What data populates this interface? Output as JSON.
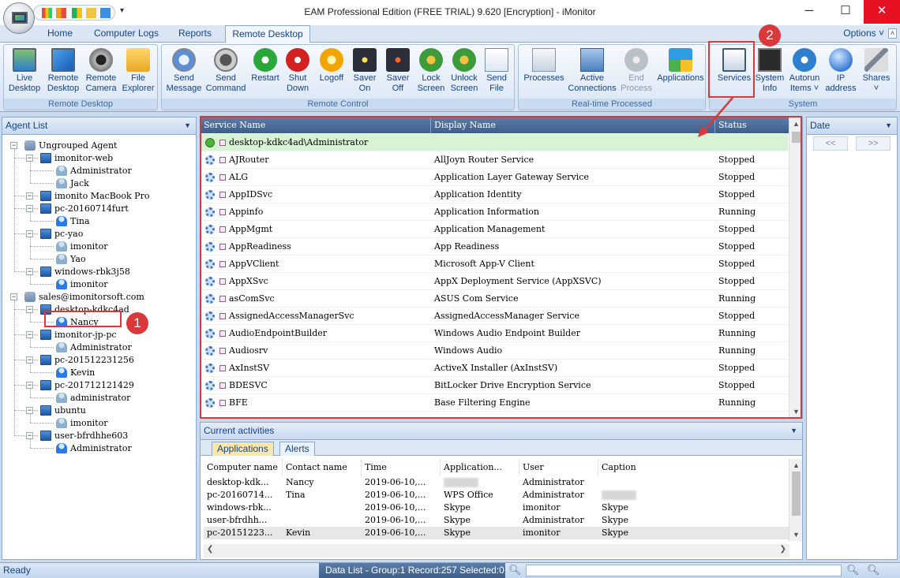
{
  "window": {
    "title": "EAM Professional Edition (FREE TRIAL) 9.620 [Encryption] - iMonitor",
    "minimize": "─",
    "maximize": "☐",
    "close": "✕"
  },
  "ribbon_tabs": [
    "Home",
    "Computer Logs",
    "Reports",
    "Remote Desktop"
  ],
  "active_tab": "Remote Desktop",
  "options_label": "Options ˅",
  "groups": {
    "remote_desktop": {
      "label": "Remote Desktop",
      "buttons": [
        {
          "l1": "Live",
          "l2": "Desktop",
          "icon": "monitor-icon"
        },
        {
          "l1": "Remote",
          "l2": "Desktop",
          "icon": "remote-desktop-icon"
        },
        {
          "l1": "Remote",
          "l2": "Camera",
          "icon": "webcam-icon"
        },
        {
          "l1": "File",
          "l2": "Explorer",
          "icon": "folder-icon"
        }
      ]
    },
    "remote_control": {
      "label": "Remote Control",
      "buttons": [
        {
          "l1": "Send",
          "l2": "Message",
          "icon": "message-icon"
        },
        {
          "l1": "Send",
          "l2": "Command",
          "icon": "command-icon"
        },
        {
          "l1": "Restart",
          "l2": "",
          "icon": "restart-icon"
        },
        {
          "l1": "Shut",
          "l2": "Down",
          "icon": "power-icon"
        },
        {
          "l1": "Logoff",
          "l2": "",
          "icon": "key-icon"
        },
        {
          "l1": "Saver",
          "l2": "On",
          "icon": "screensaver-on-icon"
        },
        {
          "l1": "Saver",
          "l2": "Off",
          "icon": "screensaver-off-icon"
        },
        {
          "l1": "Lock",
          "l2": "Screen",
          "icon": "lock-screen-icon"
        },
        {
          "l1": "Unlock",
          "l2": "Screen",
          "icon": "unlock-screen-icon"
        },
        {
          "l1": "Send",
          "l2": "File",
          "icon": "send-file-icon"
        }
      ]
    },
    "realtime": {
      "label": "Real-time Processed",
      "buttons": [
        {
          "l1": "Processes",
          "l2": "",
          "icon": "processes-icon"
        },
        {
          "l1": "Active",
          "l2": "Connections",
          "icon": "connections-icon"
        },
        {
          "l1": "End",
          "l2": "Process",
          "icon": "end-process-icon",
          "disabled": true
        },
        {
          "l1": "Applications",
          "l2": "",
          "icon": "applications-icon"
        }
      ]
    },
    "system": {
      "label": "System",
      "buttons": [
        {
          "l1": "Services",
          "l2": "",
          "icon": "services-icon"
        },
        {
          "l1": "System",
          "l2": "Info",
          "icon": "system-info-icon"
        },
        {
          "l1": "Autorun",
          "l2": "Items ˅",
          "icon": "autorun-icon"
        },
        {
          "l1": "IP",
          "l2": "address",
          "icon": "ip-address-icon"
        },
        {
          "l1": "Shares",
          "l2": "˅",
          "icon": "shares-icon"
        }
      ]
    }
  },
  "agent_list": {
    "title": "Agent List",
    "nodes": [
      {
        "label": "Ungrouped Agent",
        "level": 0,
        "type": "group"
      },
      {
        "label": "imonitor-web",
        "level": 1,
        "type": "pc"
      },
      {
        "label": "Administrator",
        "level": 2,
        "type": "user"
      },
      {
        "label": "Jack",
        "level": 2,
        "type": "user"
      },
      {
        "label": "imonito MacBook Pro",
        "level": 1,
        "type": "pc"
      },
      {
        "label": "pc-20160714furt",
        "level": 1,
        "type": "pc"
      },
      {
        "label": "Tina",
        "level": 2,
        "type": "user-blue"
      },
      {
        "label": "pc-yao",
        "level": 1,
        "type": "pc"
      },
      {
        "label": "imonitor",
        "level": 2,
        "type": "user"
      },
      {
        "label": "Yao",
        "level": 2,
        "type": "user"
      },
      {
        "label": "windows-rbk3j58",
        "level": 1,
        "type": "pc"
      },
      {
        "label": "imonitor",
        "level": 2,
        "type": "user-blue"
      },
      {
        "label": "sales@imonitorsoft.com",
        "level": 0,
        "type": "group"
      },
      {
        "label": "desktop-kdkc4ad",
        "level": 1,
        "type": "pc"
      },
      {
        "label": "Nancy",
        "level": 2,
        "type": "user-blue"
      },
      {
        "label": "imonitor-jp-pc",
        "level": 1,
        "type": "pc"
      },
      {
        "label": "Administrator",
        "level": 2,
        "type": "user"
      },
      {
        "label": "pc-201512231256",
        "level": 1,
        "type": "pc"
      },
      {
        "label": "Kevin",
        "level": 2,
        "type": "user-blue"
      },
      {
        "label": "pc-201712121429",
        "level": 1,
        "type": "pc"
      },
      {
        "label": "administrator",
        "level": 2,
        "type": "user"
      },
      {
        "label": "ubuntu",
        "level": 1,
        "type": "pc"
      },
      {
        "label": "imonitor",
        "level": 2,
        "type": "user"
      },
      {
        "label": "user-bfrdhhe603",
        "level": 1,
        "type": "pc"
      },
      {
        "label": "Administrator",
        "level": 2,
        "type": "user-blue"
      }
    ]
  },
  "services": {
    "columns": [
      "Service Name",
      "Display Name",
      "Status"
    ],
    "rows": [
      {
        "name": "desktop-kdkc4ad\\Administrator",
        "display": "",
        "status": "",
        "header": true
      },
      {
        "name": "AJRouter",
        "display": "AllJoyn Router Service",
        "status": "Stopped"
      },
      {
        "name": "ALG",
        "display": "Application Layer Gateway Service",
        "status": "Stopped"
      },
      {
        "name": "AppIDSvc",
        "display": "Application Identity",
        "status": "Stopped"
      },
      {
        "name": "Appinfo",
        "display": "Application Information",
        "status": "Running"
      },
      {
        "name": "AppMgmt",
        "display": "Application Management",
        "status": "Stopped"
      },
      {
        "name": "AppReadiness",
        "display": "App Readiness",
        "status": "Stopped"
      },
      {
        "name": "AppVClient",
        "display": "Microsoft App-V Client",
        "status": "Stopped"
      },
      {
        "name": "AppXSvc",
        "display": "AppX Deployment Service (AppXSVC)",
        "status": "Stopped"
      },
      {
        "name": "asComSvc",
        "display": "ASUS Com Service",
        "status": "Running"
      },
      {
        "name": "AssignedAccessManagerSvc",
        "display": "AssignedAccessManager Service",
        "status": "Stopped"
      },
      {
        "name": "AudioEndpointBuilder",
        "display": "Windows Audio Endpoint Builder",
        "status": "Running"
      },
      {
        "name": "Audiosrv",
        "display": "Windows Audio",
        "status": "Running"
      },
      {
        "name": "AxInstSV",
        "display": "ActiveX Installer (AxInstSV)",
        "status": "Stopped"
      },
      {
        "name": "BDESVC",
        "display": "BitLocker Drive Encryption Service",
        "status": "Stopped"
      },
      {
        "name": "BFE",
        "display": "Base Filtering Engine",
        "status": "Running"
      }
    ]
  },
  "date_panel": {
    "title": "Date",
    "prev": "<<",
    "next": ">>"
  },
  "activities": {
    "title": "Current activities",
    "tabs": [
      "Applications",
      "Alerts"
    ],
    "columns": [
      "Computer name",
      "Contact name",
      "Time",
      "Application...",
      "User",
      "Caption"
    ],
    "rows": [
      {
        "computer": "desktop-kdk...",
        "contact": "Nancy",
        "time": "2019-06-10,...",
        "app": "",
        "user": "Administrator",
        "caption": ""
      },
      {
        "computer": "pc-20160714...",
        "contact": "Tina",
        "time": "2019-06-10,...",
        "app": "WPS Office",
        "user": "Administrator",
        "caption": ""
      },
      {
        "computer": "windows-rbk...",
        "contact": "",
        "time": "2019-06-10,...",
        "app": "Skype",
        "user": "imonitor",
        "caption": "Skype"
      },
      {
        "computer": "user-bfrdhh...",
        "contact": "",
        "time": "2019-06-10,...",
        "app": "Skype",
        "user": "Administrator",
        "caption": "Skype"
      },
      {
        "computer": "pc-20151223...",
        "contact": "Kevin",
        "time": "2019-06-10,...",
        "app": "Skype",
        "user": "imonitor",
        "caption": "Skype"
      }
    ]
  },
  "statusbar": {
    "ready": "Ready",
    "datalist": "Data List - Group:1  Record:257  Selected:0"
  },
  "annotations": {
    "badge1": "1",
    "badge2": "2",
    "color": "#d9393b"
  }
}
